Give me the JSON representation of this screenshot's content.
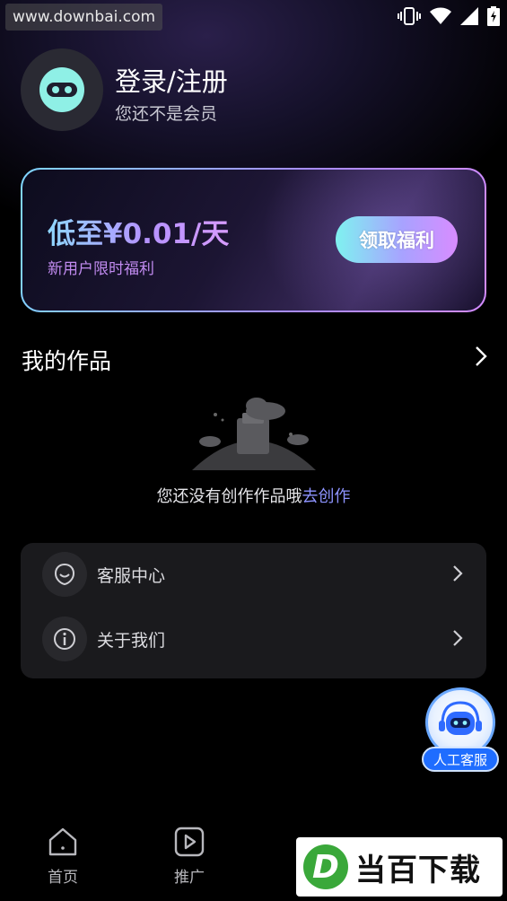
{
  "watermark": {
    "text": "www.downbai.com"
  },
  "status_bar": {
    "icons": [
      "vibrate-icon",
      "wifi-icon",
      "signal-icon",
      "battery-charging-icon"
    ]
  },
  "profile": {
    "title": "登录/注册",
    "subtitle": "您还不是会员"
  },
  "promo": {
    "price": "低至¥0.01/天",
    "subtitle": "新用户限时福利",
    "button": "领取福利"
  },
  "works": {
    "title": "我的作品",
    "empty_text": "您还没有创作作品哦",
    "empty_link": "去创作"
  },
  "menu": {
    "items": [
      {
        "label": "客服中心",
        "icon": "customer-service-icon"
      },
      {
        "label": "关于我们",
        "icon": "info-icon"
      }
    ]
  },
  "floating": {
    "label": "人工客服"
  },
  "tabbar": {
    "tabs": [
      {
        "label": "首页",
        "icon": "home-icon"
      },
      {
        "label": "推广",
        "icon": "play-icon"
      }
    ]
  },
  "logo_overlay": {
    "text": "当百下载",
    "mark": "D"
  },
  "colors": {
    "accent": "#8d93ff",
    "button_gradient_start": "#7ff2f0",
    "button_gradient_end": "#d88cff",
    "badge": "#1f6dff"
  }
}
